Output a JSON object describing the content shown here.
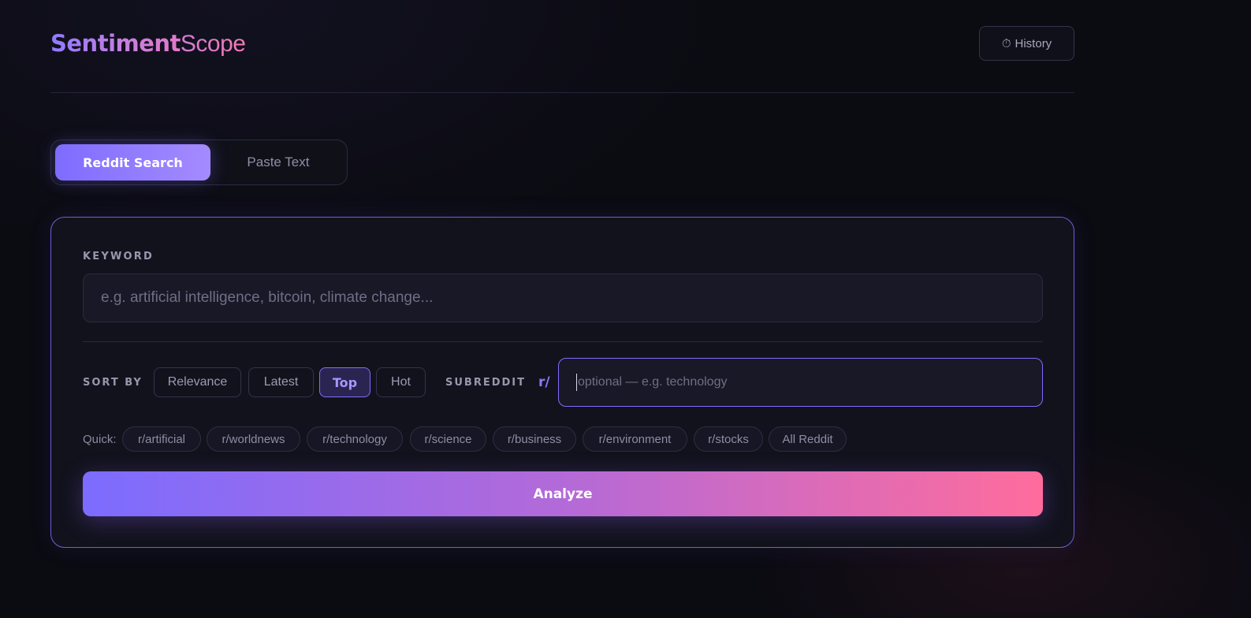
{
  "header": {
    "logo_strong": "Sentiment",
    "logo_light": "Scope",
    "history_label": "History",
    "history_icon": "stopwatch-icon"
  },
  "mode_toggle": {
    "reddit_label": "Reddit Search",
    "paste_label": "Paste Text",
    "active": "Reddit Search"
  },
  "form": {
    "keyword_label": "KEYWORD",
    "keyword_placeholder": "e.g. artificial intelligence, bitcoin, climate change...",
    "sort_label": "SORT BY",
    "sort_options": [
      "Relevance",
      "Latest",
      "Top",
      "Hot"
    ],
    "sort_selected": "Top",
    "subreddit_label": "SUBREDDIT",
    "subreddit_prefix": "r/",
    "subreddit_placeholder": "optional — e.g. technology",
    "quick_label": "Quick:",
    "quick_chips": [
      "r/artificial",
      "r/worldnews",
      "r/technology",
      "r/science",
      "r/business",
      "r/environment",
      "r/stocks",
      "All Reddit"
    ],
    "analyze_label": "Analyze"
  },
  "colors": {
    "accent": "#7e6cff",
    "accent_pink": "#ff6c9c",
    "background": "#0b0b12"
  }
}
